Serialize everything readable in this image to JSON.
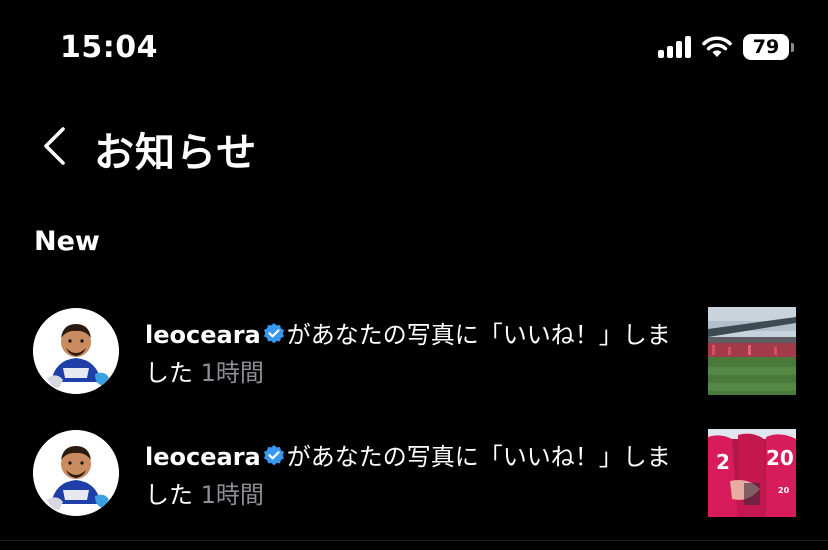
{
  "status_bar": {
    "time": "15:04",
    "battery_percent": "79",
    "signal_icon": "cellular-signal-icon",
    "wifi_icon": "wifi-icon",
    "battery_icon": "battery-icon"
  },
  "header": {
    "back_icon": "chevron-left-icon",
    "title": "お知らせ"
  },
  "section": {
    "title": "New"
  },
  "notifications": [
    {
      "username": "leoceara",
      "verified_icon": "verified-badge-icon",
      "message": "があなたの写真に「いいね！」しました",
      "time_ago": "1時間",
      "avatar_icon": "avatar-cartoon-icon",
      "thumbnail_icon": "stadium-photo-thumbnail"
    },
    {
      "username": "leoceara",
      "verified_icon": "verified-badge-icon",
      "message": "があなたの写真に「いいね！」しました",
      "time_ago": "1時間",
      "avatar_icon": "avatar-cartoon-icon",
      "thumbnail_icon": "jersey-photo-thumbnail"
    }
  ],
  "colors": {
    "background": "#000000",
    "text_primary": "#ffffff",
    "text_secondary": "#8e8e93",
    "verified_blue": "#3897f0",
    "jersey_pink": "#d81b5a"
  }
}
